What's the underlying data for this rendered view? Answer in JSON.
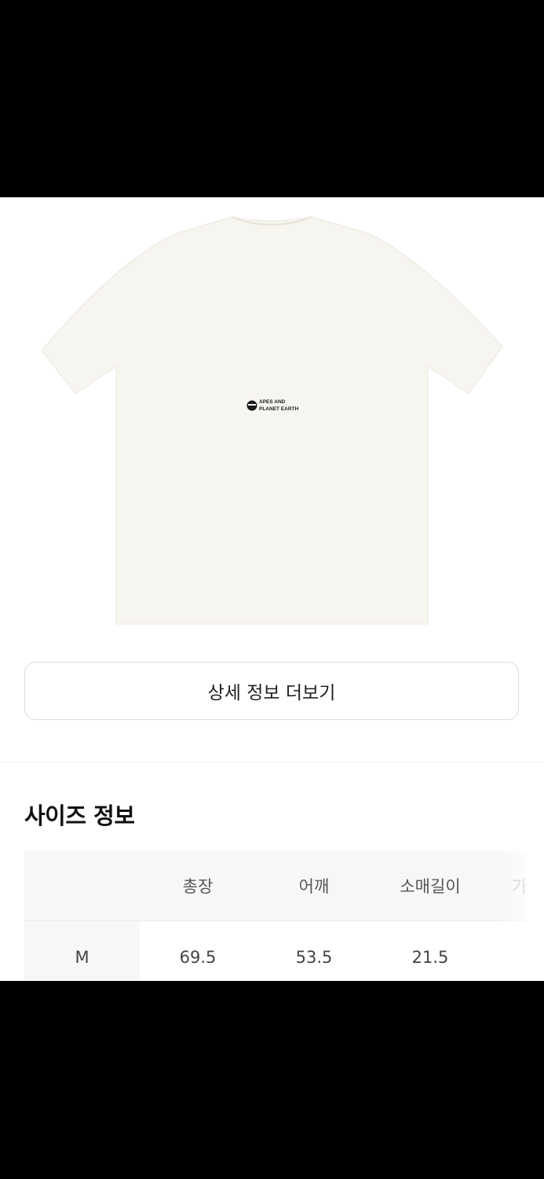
{
  "product": {
    "image_alt": "white t-shirt back view",
    "print_line1": "APES AND",
    "print_line2": "PLANET EARTH"
  },
  "more_button_label": "상세 정보 더보기",
  "size_section": {
    "title": "사이즈 정보",
    "columns": [
      "",
      "총장",
      "어깨",
      "소매길이",
      "가"
    ],
    "rows": [
      {
        "size": "M",
        "values": [
          "69.5",
          "53.5",
          "21.5",
          ""
        ]
      }
    ]
  },
  "colors": {
    "shirt": "#f7f5ef",
    "border": "#dcdcdc",
    "header_bg": "#f7f7f7"
  }
}
